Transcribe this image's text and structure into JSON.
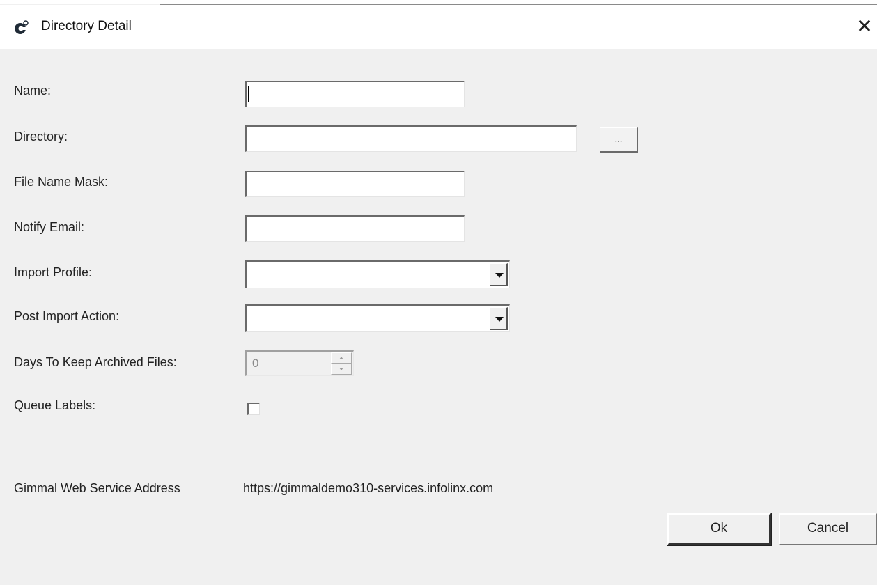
{
  "window": {
    "title": "Directory Detail",
    "close_glyph": "✕",
    "app_icon": "gimmal-logo-icon"
  },
  "form": {
    "name": {
      "label": "Name:",
      "value": ""
    },
    "directory": {
      "label": "Directory:",
      "value": "",
      "browse_label": "..."
    },
    "file_name_mask": {
      "label": "File Name Mask:",
      "value": ""
    },
    "notify_email": {
      "label": "Notify Email:",
      "value": ""
    },
    "import_profile": {
      "label": "Import Profile:",
      "value": ""
    },
    "post_import_action": {
      "label": "Post Import Action:",
      "value": ""
    },
    "days_to_keep": {
      "label": "Days To Keep Archived Files:",
      "value": "0",
      "enabled": false
    },
    "queue_labels": {
      "label": "Queue Labels:",
      "checked": false
    }
  },
  "service": {
    "label": "Gimmal Web Service Address",
    "value": "https://gimmaldemo310-services.infolinx.com"
  },
  "buttons": {
    "ok": "Ok",
    "cancel": "Cancel"
  },
  "colors": {
    "dialog_background": "#f0f0f0",
    "titlebar_background": "#ffffff"
  }
}
